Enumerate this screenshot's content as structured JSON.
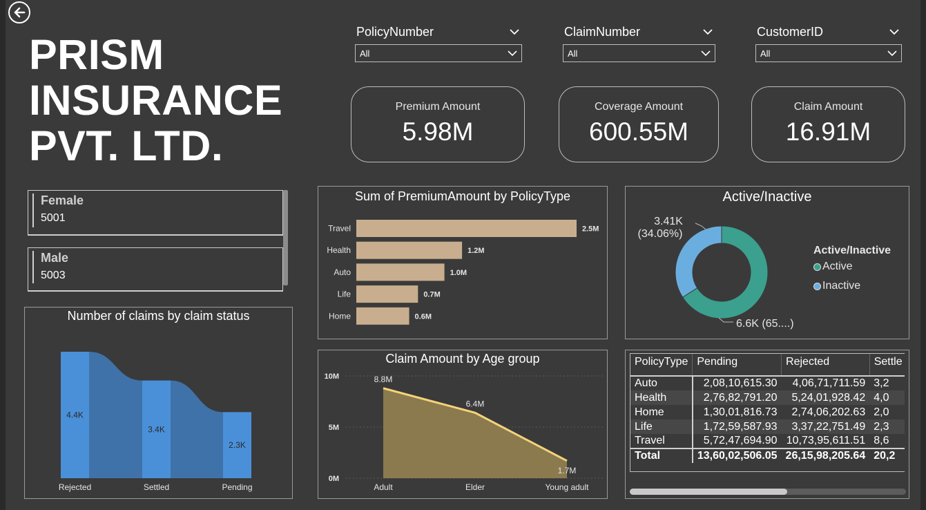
{
  "title": {
    "line1": "PRISM",
    "line2": "INSURANCE",
    "line3": "PVT. LTD."
  },
  "slicers": [
    {
      "label": "PolicyNumber",
      "value": "All"
    },
    {
      "label": "ClaimNumber",
      "value": "All"
    },
    {
      "label": "CustomerID",
      "value": "All"
    }
  ],
  "kpis": [
    {
      "label": "Premium Amount",
      "value": "5.98M"
    },
    {
      "label": "Coverage Amount",
      "value": "600.55M"
    },
    {
      "label": "Claim Amount",
      "value": "16.91M"
    }
  ],
  "gender": [
    {
      "label": "Female",
      "value": "5001"
    },
    {
      "label": "Male",
      "value": "5003"
    }
  ],
  "colors": {
    "background": "#3a3a3a",
    "bar_premium": "#c8ae8e",
    "ribbon": "#4a90d9",
    "donut_active": "#3ba08e",
    "donut_inactive": "#6aaee0",
    "area_fill": "#8a7a4e",
    "line": "#f5d37a"
  },
  "icons": {
    "back": "arrow-left-circle-icon",
    "dropdown": "chevron-down-icon"
  },
  "charts": {
    "premium_by_policytype": {
      "title": "Sum of PremiumAmount by PolicyType",
      "chart_data": {
        "type": "bar",
        "orientation": "horizontal",
        "categories": [
          "Travel",
          "Health",
          "Auto",
          "Life",
          "Home"
        ],
        "values": [
          2.5,
          1.2,
          1.0,
          0.7,
          0.6
        ],
        "labels": [
          "2.5M",
          "1.2M",
          "1.0M",
          "0.7M",
          "0.6M"
        ],
        "xlim": [
          0,
          2.5
        ]
      }
    },
    "claims_by_status": {
      "title": "Number of claims by claim status",
      "chart_data": {
        "type": "bar",
        "subtype": "ribbon",
        "categories": [
          "Rejected",
          "Settled",
          "Pending"
        ],
        "values": [
          4.4,
          3.4,
          2.3
        ],
        "labels": [
          "4.4K",
          "3.4K",
          "2.3K"
        ],
        "ylim": [
          0,
          4.4
        ]
      }
    },
    "active_inactive": {
      "title": "Active/Inactive",
      "legend_title": "Active/Inactive",
      "legend_placement": "right",
      "chart_data": {
        "type": "pie",
        "subtype": "donut",
        "categories": [
          "Active",
          "Inactive"
        ],
        "values": [
          6.6,
          3.41
        ],
        "labels": [
          {
            "value": "6.6K",
            "pct": "(65....)"
          },
          {
            "value": "3.41K",
            "pct": "(34.06%)"
          }
        ]
      }
    },
    "claim_by_age": {
      "title": "Claim Amount by Age group",
      "chart_data": {
        "type": "area",
        "categories": [
          "Adult",
          "Elder",
          "Young adult"
        ],
        "values": [
          8.8,
          6.4,
          1.7
        ],
        "labels": [
          "8.8M",
          "6.4M",
          "1.7M"
        ],
        "yticks": [
          "10M",
          "5M",
          "0M"
        ],
        "ylim": [
          0,
          10
        ],
        "grid": true
      }
    }
  },
  "matrix": {
    "headers": [
      "PolicyType",
      "Pending",
      "Rejected",
      "Settle"
    ],
    "rows": [
      {
        "type": "Auto",
        "pending": "2,08,10,615.30",
        "rejected": "4,06,71,711.59",
        "settled": "3,2"
      },
      {
        "type": "Health",
        "pending": "2,76,82,791.20",
        "rejected": "5,24,01,928.42",
        "settled": "4,0"
      },
      {
        "type": "Home",
        "pending": "1,30,01,816.73",
        "rejected": "2,74,06,202.63",
        "settled": "2,0"
      },
      {
        "type": "Life",
        "pending": "1,72,59,587.93",
        "rejected": "3,37,22,751.49",
        "settled": "2,3"
      },
      {
        "type": "Travel",
        "pending": "5,72,47,694.90",
        "rejected": "10,73,95,611.51",
        "settled": "8,6"
      }
    ],
    "total": {
      "type": "Total",
      "pending": "13,60,02,506.05",
      "rejected": "26,15,98,205.64",
      "settled": "20,2"
    }
  }
}
